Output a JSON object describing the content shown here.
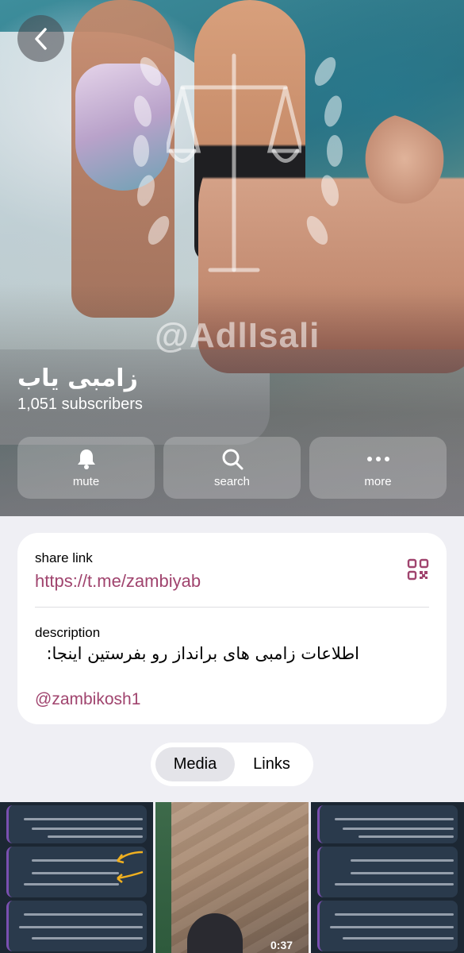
{
  "header": {
    "back_icon": "chevron-left-icon",
    "channel_name": "زامبی یاب",
    "subscribers": "1,051 subscribers",
    "watermark": "@AdlIsali"
  },
  "actions": [
    {
      "label": "mute",
      "icon": "bell-icon"
    },
    {
      "label": "search",
      "icon": "search-icon"
    },
    {
      "label": "more",
      "icon": "more-icon"
    }
  ],
  "info": {
    "share_label": "share link",
    "share_url": "https://t.me/zambiyab",
    "description_label": "description",
    "description_text": "اطلاعات زامبی های برانداز رو بفرستین اینجا:",
    "description_handle": "@zambikosh1",
    "accent": "#a0446e"
  },
  "tabs": {
    "media": "Media",
    "links": "Links",
    "active": "Media"
  },
  "media": {
    "video_duration": "0:37"
  }
}
